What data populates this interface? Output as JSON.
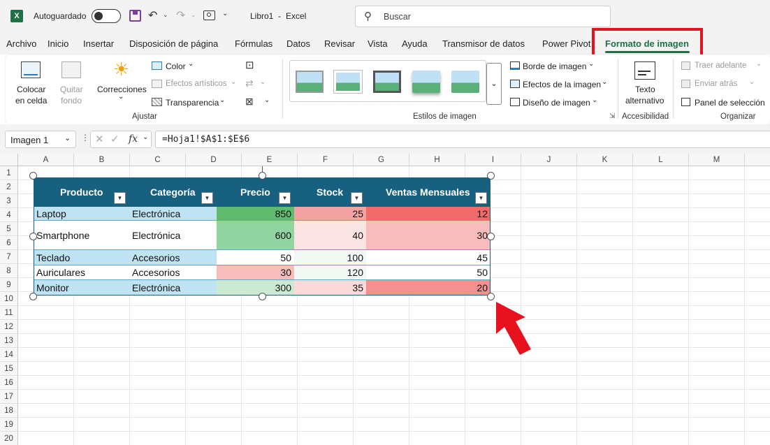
{
  "titlebar": {
    "autosave": "Autoguardado",
    "filename": "Libro1",
    "separator": "-",
    "app": "Excel",
    "search_placeholder": "Buscar"
  },
  "tabs": [
    "Archivo",
    "Inicio",
    "Insertar",
    "Disposición de página",
    "Fórmulas",
    "Datos",
    "Revisar",
    "Vista",
    "Ayuda",
    "Transmisor de datos",
    "Power Pivot",
    "Formato de imagen"
  ],
  "ribbon": {
    "colocar1": "Colocar",
    "colocar2": "en celda",
    "quitar1": "Quitar",
    "quitar2": "fondo",
    "correcciones": "Correcciones",
    "color": "Color",
    "efectos_art": "Efectos artísticos",
    "transparencia": "Transparencia",
    "ajustar": "Ajustar",
    "estilos": "Estilos de imagen",
    "borde": "Borde de imagen",
    "efectos_img": "Efectos de la imagen",
    "diseno": "Diseño de imagen",
    "texto1": "Texto",
    "texto2": "alternativo",
    "accesibilidad": "Accesibilidad",
    "traer": "Traer adelante",
    "enviar": "Enviar atrás",
    "panel": "Panel de selección",
    "organizar": "Organizar"
  },
  "formula": {
    "namebox": "Imagen 1",
    "fx": "fx",
    "value": "=Hoja1!$A$1:$E$6"
  },
  "columns": [
    "A",
    "B",
    "C",
    "D",
    "E",
    "F",
    "G",
    "H",
    "I",
    "J",
    "K",
    "L",
    "M"
  ],
  "rows": [
    "1",
    "2",
    "3",
    "4",
    "5",
    "6",
    "7",
    "8",
    "9",
    "10",
    "11",
    "12",
    "13",
    "14",
    "15",
    "16",
    "17",
    "18",
    "19",
    "20"
  ],
  "table": {
    "headers": [
      "Producto",
      "Categoría",
      "Precio",
      "Stock",
      "Ventas Mensuales"
    ],
    "rows": [
      [
        "Laptop",
        "Electrónica",
        "850",
        "25",
        "12"
      ],
      [
        "Smartphone",
        "Electrónica",
        "600",
        "40",
        "30"
      ],
      [
        "Teclado",
        "Accesorios",
        "50",
        "100",
        "45"
      ],
      [
        "Auriculares",
        "Accesorios",
        "30",
        "120",
        "50"
      ],
      [
        "Monitor",
        "Electrónica",
        "300",
        "35",
        "20"
      ]
    ]
  },
  "colors": {
    "accent_green": "#1e7145",
    "highlight_red": "#e8121f",
    "header_blue": "#18607f",
    "arrow_red": "#e8121f"
  }
}
